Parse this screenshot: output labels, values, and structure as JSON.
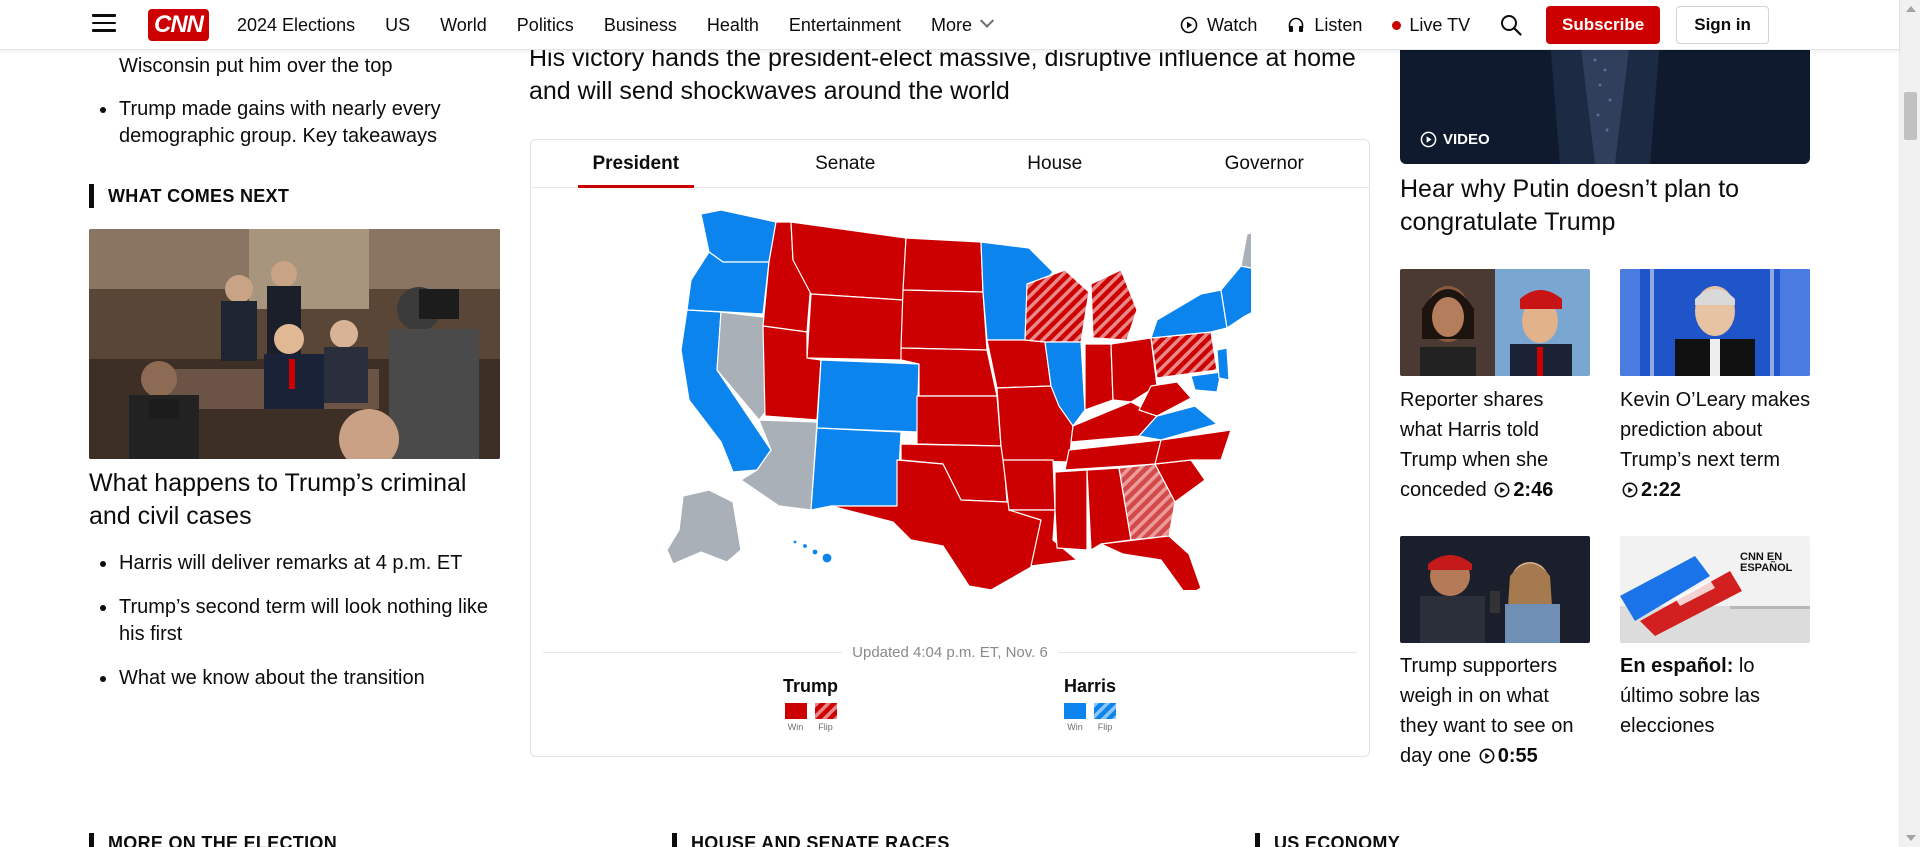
{
  "colors": {
    "brand": "#cc0000",
    "trump_red": "#cc0000",
    "harris_blue": "#0b84ed",
    "undecided_gray": "#a9b0b8"
  },
  "nav": {
    "logo": "CNN",
    "links": [
      "2024 Elections",
      "US",
      "World",
      "Politics",
      "Business",
      "Health",
      "Entertainment"
    ],
    "more": "More",
    "watch": "Watch",
    "listen": "Listen",
    "live_tv": "Live TV",
    "subscribe": "Subscribe",
    "sign_in": "Sign in",
    "icons": [
      "menu-icon",
      "play-circle-icon",
      "headphones-icon",
      "live-dot-icon",
      "search-icon"
    ]
  },
  "left": {
    "top_bullet_continued": "Wisconsin put him over the top",
    "top_bullets": [
      "Trump made gains with nearly every demographic group. Key takeaways"
    ],
    "section_label": "WHAT COMES NEXT",
    "story_headline": "What happens to Trump’s criminal and civil cases",
    "story_bullets": [
      "Harris will deliver remarks at 4 p.m. ET",
      "Trump’s second term will look nothing like his first",
      "What we know about the transition"
    ]
  },
  "center": {
    "sub_headline": "His victory hands the president-elect massive, disruptive influence at home and will send shockwaves around the world",
    "tabs": [
      "President",
      "Senate",
      "House",
      "Governor"
    ],
    "active_tab": "President",
    "updated": "Updated 4:04 p.m. ET, Nov. 6",
    "legend": {
      "trump": {
        "name": "Trump",
        "win": "Win",
        "flip": "Flip"
      },
      "harris": {
        "name": "Harris",
        "win": "Win",
        "flip": "Flip"
      }
    }
  },
  "right": {
    "video_badge": "VIDEO",
    "top_headline": "Hear why Putin doesn’t plan to congratulate Trump",
    "cards": [
      {
        "title": "Reporter shares what Harris told Trump when she conceded",
        "duration": "2:46"
      },
      {
        "title": "Kevin O’Leary makes prediction about Trump’s next term",
        "duration": "2:22"
      },
      {
        "title": "Trump supporters weigh in on what they want to see on day one",
        "duration": "0:55"
      },
      {
        "title_bold": "En español:",
        "title": "lo último sobre las elecciones",
        "image_text": "CNN EN ESPAÑOL"
      }
    ]
  },
  "bottom": {
    "sections": [
      "MORE ON THE ELECTION",
      "HOUSE AND SENATE RACES",
      "US ECONOMY"
    ]
  }
}
